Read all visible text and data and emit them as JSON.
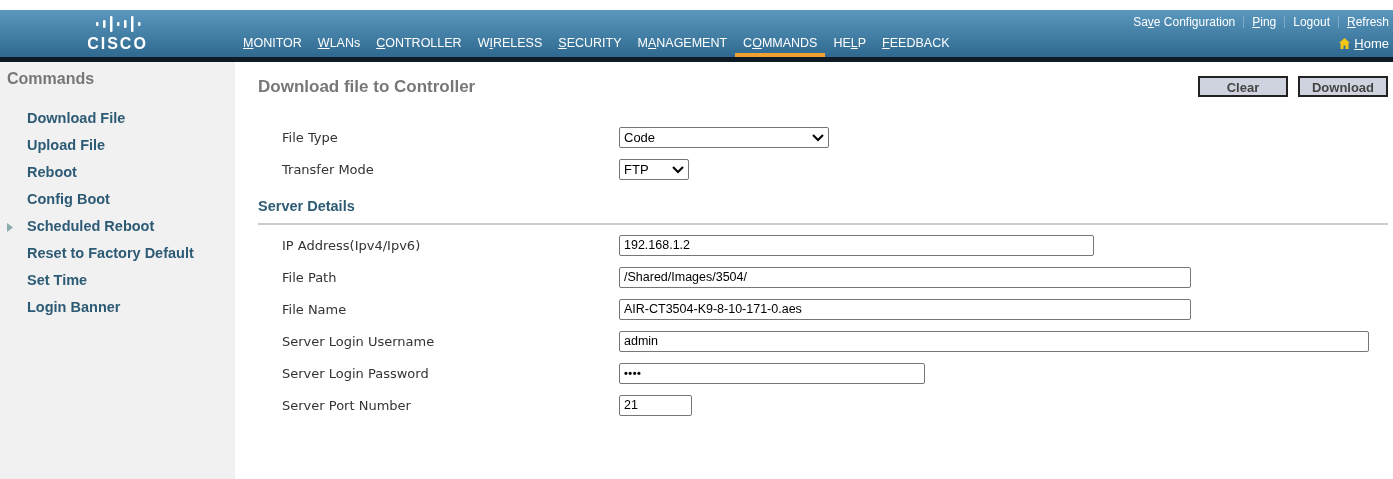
{
  "header": {
    "logo": "CISCO",
    "top_links": [
      {
        "pre": "Sa",
        "key": "v",
        "post": "e Configuration"
      },
      {
        "key": "P",
        "post": "ing"
      },
      {
        "pre": "Logout"
      },
      {
        "key": "R",
        "post": "efresh"
      }
    ],
    "menu": [
      {
        "key": "M",
        "post": "ONITOR",
        "selected": false
      },
      {
        "key": "W",
        "post": "LANs",
        "selected": false
      },
      {
        "key": "C",
        "post": "ONTROLLER",
        "selected": false
      },
      {
        "pre": "W",
        "key": "I",
        "post": "RELESS",
        "selected": false
      },
      {
        "key": "S",
        "post": "ECURITY",
        "selected": false
      },
      {
        "pre": "M",
        "key": "A",
        "post": "NAGEMENT",
        "selected": false
      },
      {
        "pre": "C",
        "key": "O",
        "post": "MMANDS",
        "selected": true
      },
      {
        "pre": "HE",
        "key": "L",
        "post": "P",
        "selected": false
      },
      {
        "key": "F",
        "post": "EEDBACK",
        "selected": false
      }
    ],
    "home": {
      "key": "H",
      "post": "ome"
    }
  },
  "sidebar": {
    "title": "Commands",
    "items": [
      {
        "label": "Download File",
        "expandable": false
      },
      {
        "label": "Upload File",
        "expandable": false
      },
      {
        "label": "Reboot",
        "expandable": false
      },
      {
        "label": "Config Boot",
        "expandable": false
      },
      {
        "label": "Scheduled Reboot",
        "expandable": true
      },
      {
        "label": "Reset to Factory Default",
        "expandable": false
      },
      {
        "label": "Set Time",
        "expandable": false
      },
      {
        "label": "Login Banner",
        "expandable": false
      }
    ]
  },
  "main": {
    "title": "Download file to Controller",
    "buttons": [
      "Clear",
      "Download"
    ],
    "fields": [
      {
        "label": "File Type",
        "kind": "select",
        "value": "Code"
      },
      {
        "label": "Transfer Mode",
        "kind": "select",
        "value": "FTP"
      }
    ],
    "section": "Server Details",
    "server_fields": [
      {
        "label": "IP Address(Ipv4/Ipv6)",
        "kind": "text",
        "value": "192.168.1.2"
      },
      {
        "label": "File Path",
        "kind": "text",
        "value": "/Shared/Images/3504/"
      },
      {
        "label": "File Name",
        "kind": "text",
        "value": "AIR-CT3504-K9-8-10-171-0.aes"
      },
      {
        "label": "Server Login Username",
        "kind": "text",
        "value": "admin"
      },
      {
        "label": "Server Login Password",
        "kind": "password",
        "value": "••••"
      },
      {
        "label": "Server Port Number",
        "kind": "text",
        "value": "21"
      }
    ]
  }
}
